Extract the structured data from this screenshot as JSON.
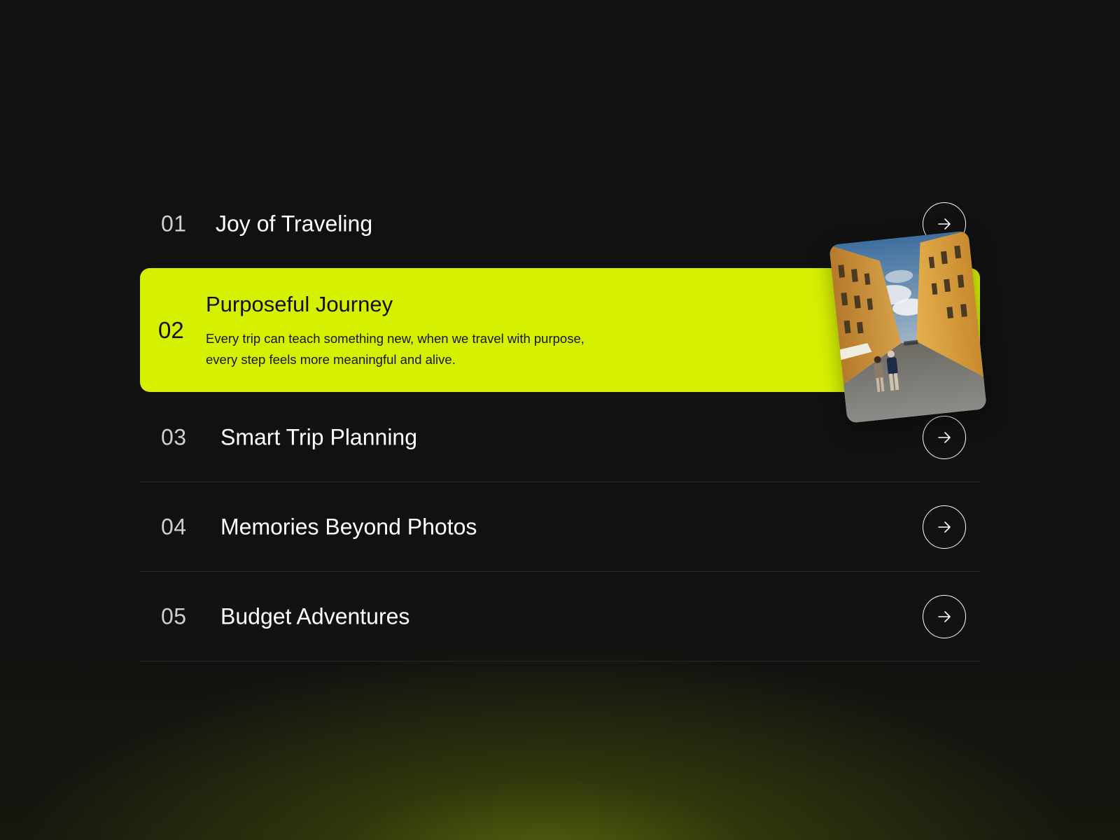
{
  "items": [
    {
      "number": "01",
      "title": "Joy of Traveling",
      "action_icon": "arrow-right-icon"
    },
    {
      "number": "02",
      "title": "Purposeful Journey",
      "description_line1": "Every trip can teach something new, when we travel with purpose,",
      "description_line2": "every step feels more meaningful and alive.",
      "action_icon": "arrow-up-right-icon",
      "active": true
    },
    {
      "number": "03",
      "title": "Smart Trip Planning",
      "action_icon": "arrow-right-icon"
    },
    {
      "number": "04",
      "title": "Memories Beyond Photos",
      "action_icon": "arrow-right-icon"
    },
    {
      "number": "05",
      "title": "Budget Adventures",
      "action_icon": "arrow-right-icon"
    }
  ],
  "colors": {
    "background": "#111111",
    "accent": "#d6f002",
    "text_light": "#ffffff",
    "number_light": "#cfcfcf",
    "text_dark": "#111111",
    "glow": "#5a6a0c"
  }
}
